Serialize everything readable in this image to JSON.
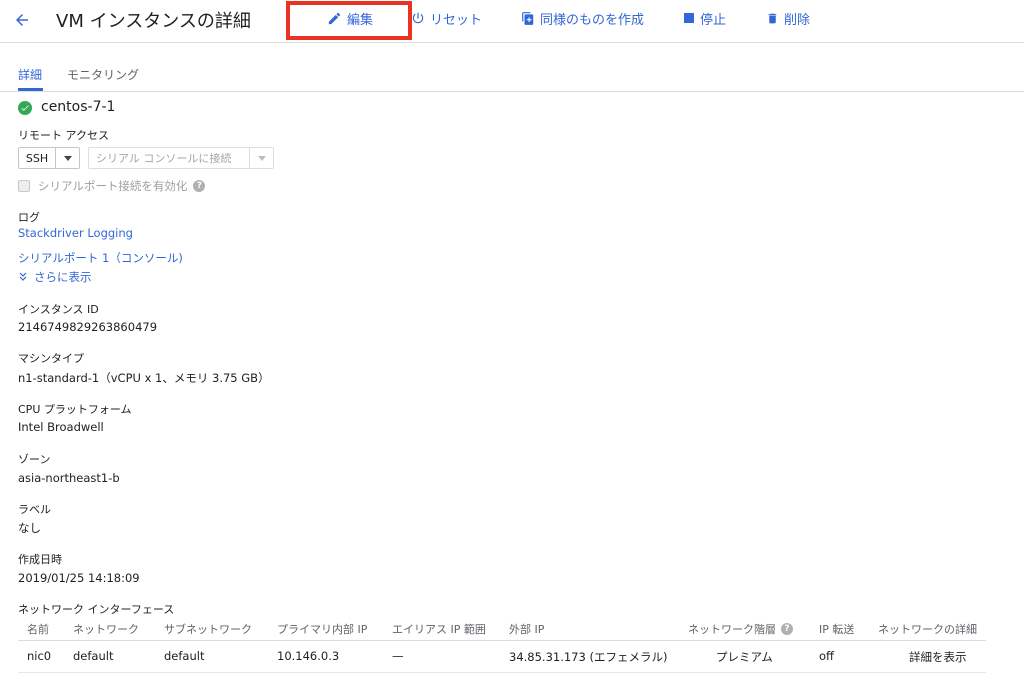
{
  "header": {
    "title": "VM インスタンスの詳細",
    "edit": "編集",
    "reset": "リセット",
    "clone": "同様のものを作成",
    "stop": "停止",
    "delete": "削除"
  },
  "tabs": [
    "詳細",
    "モニタリング"
  ],
  "instance": {
    "name": "centos-7-1",
    "status_icon": "check-circle-icon"
  },
  "remote_access": {
    "label": "リモート アクセス",
    "ssh_label": "SSH",
    "serial_console_label": "シリアル コンソールに接続",
    "serial_port_checkbox_label": "シリアルポート接続を有効化"
  },
  "logs": {
    "label": "ログ",
    "stackdriver_link": "Stackdriver Logging",
    "serial_port_link": "シリアルポート 1（コンソール)",
    "show_more": "さらに表示"
  },
  "fields": [
    {
      "label": "インスタンス ID",
      "value": "2146749829263860479"
    },
    {
      "label": "マシンタイプ",
      "value": "n1-standard-1（vCPU x 1、メモリ 3.75 GB）"
    },
    {
      "label": "CPU プラットフォーム",
      "value": "Intel Broadwell"
    },
    {
      "label": "ゾーン",
      "value": "asia-northeast1-b"
    },
    {
      "label": "ラベル",
      "value": "なし"
    },
    {
      "label": "作成日時",
      "value": "2019/01/25 14:18:09"
    }
  ],
  "network": {
    "label": "ネットワーク インターフェース",
    "columns": [
      "名前",
      "ネットワーク",
      "サブネットワーク",
      "プライマリ内部 IP",
      "エイリアス IP 範囲",
      "外部 IP",
      "ネットワーク階層",
      "IP 転送",
      "ネットワークの詳細"
    ],
    "row": [
      "nic0",
      "default",
      "default",
      "10.146.0.3",
      "—",
      "34.85.31.173 (エフェメラル)",
      "プレミアム",
      "off",
      "詳細を表示"
    ]
  },
  "colors": {
    "accent": "#3367d6",
    "highlight": "#ea3323",
    "status_ok": "#34a853"
  }
}
